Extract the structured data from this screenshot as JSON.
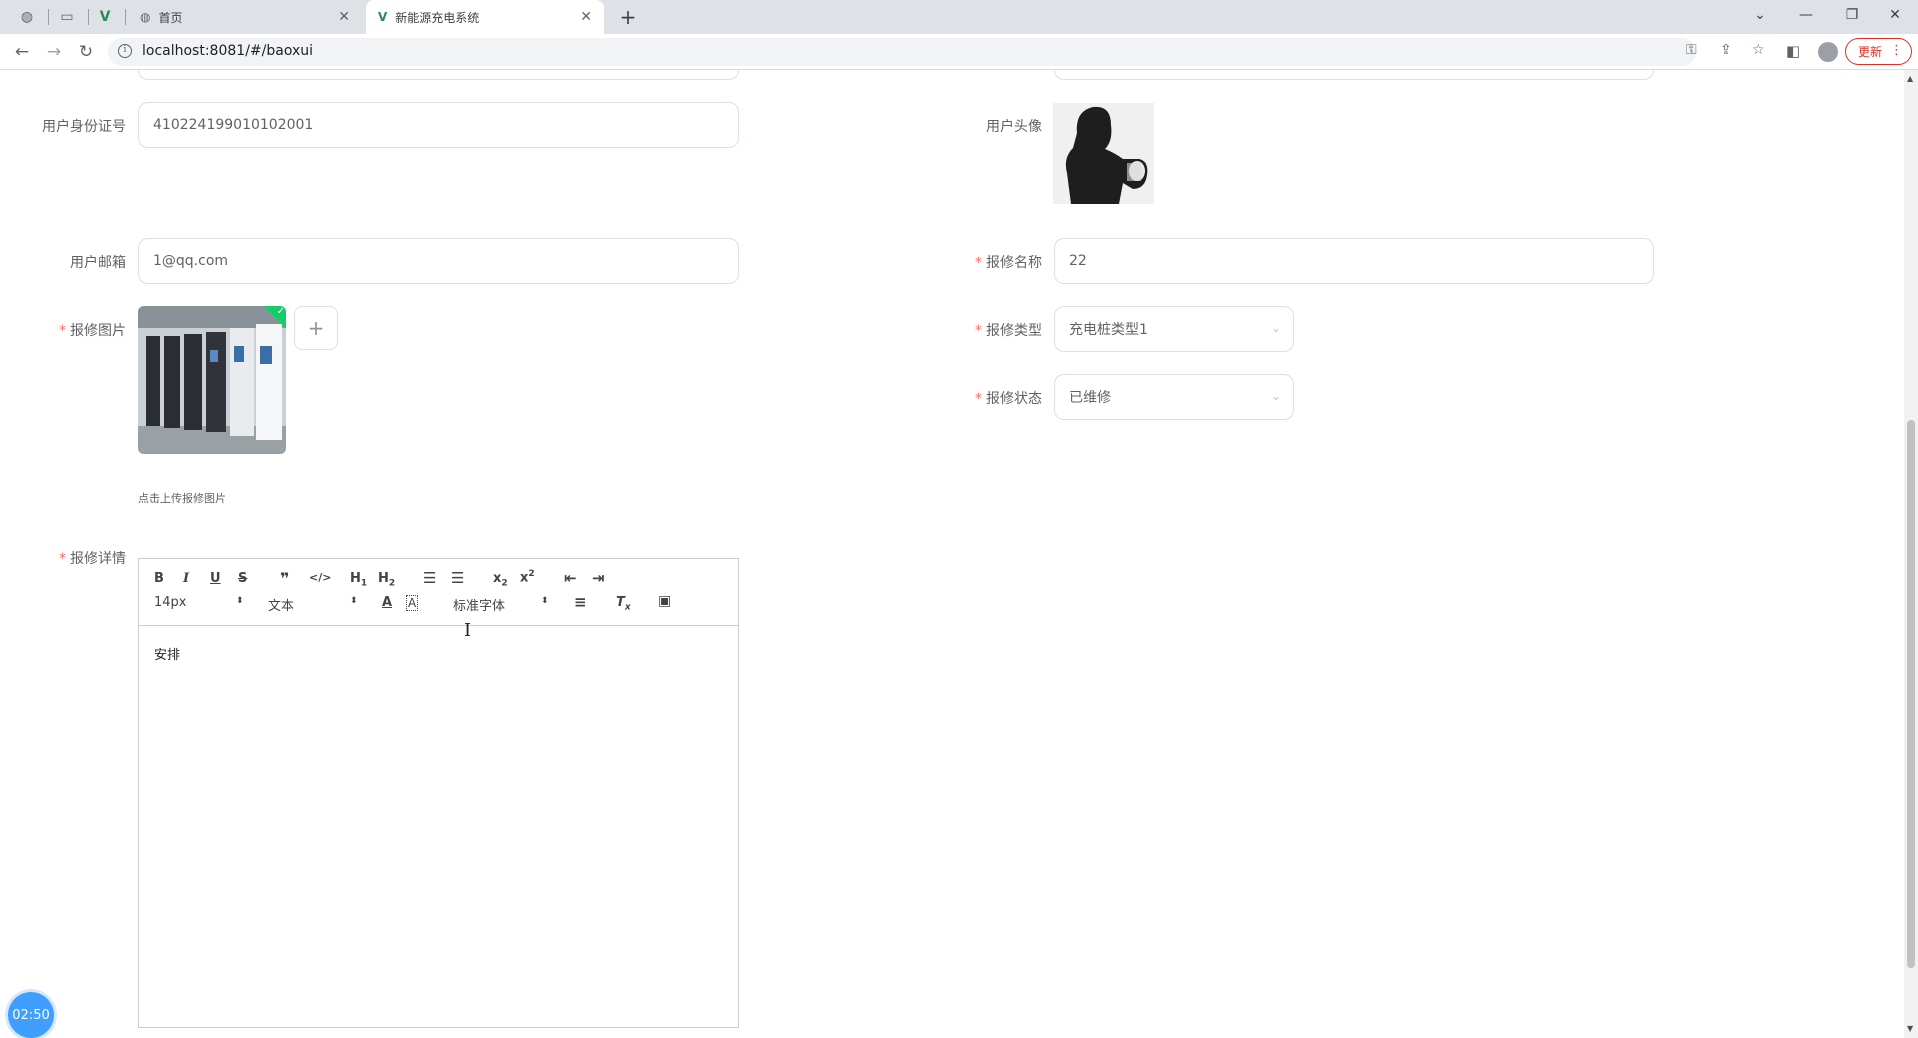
{
  "browser": {
    "tabs": [
      {
        "title": "首页"
      },
      {
        "title": "新能源充电系统"
      }
    ],
    "url": "localhost:8081/#/baoxui",
    "update_label": "更新"
  },
  "form": {
    "id_card": {
      "label": "用户身份证号",
      "value": "410224199010102001"
    },
    "avatar": {
      "label": "用户头像"
    },
    "email": {
      "label": "用户邮箱",
      "value": "1@qq.com"
    },
    "repair_name": {
      "label": "报修名称",
      "value": "22"
    },
    "repair_image": {
      "label": "报修图片",
      "hint": "点击上传报修图片"
    },
    "repair_type": {
      "label": "报修类型",
      "value": "充电桩类型1"
    },
    "repair_status": {
      "label": "报修状态",
      "value": "已维修"
    },
    "repair_detail": {
      "label": "报修详情",
      "toolbar": {
        "size": "14px",
        "format": "文本",
        "font": "标准字体"
      },
      "content": "安排"
    }
  },
  "timer": "02:50",
  "required_mark": "*"
}
